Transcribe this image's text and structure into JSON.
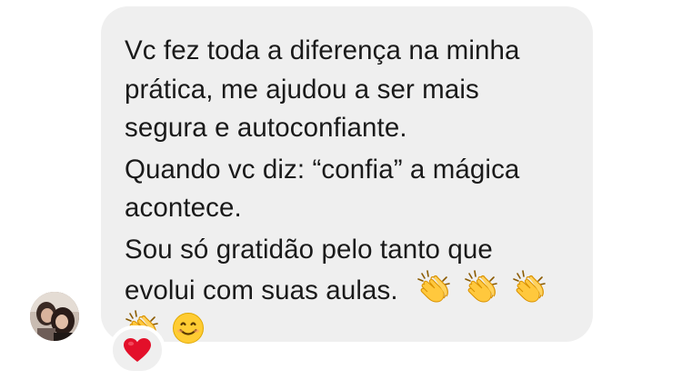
{
  "message": {
    "paragraphs": [
      [
        "Vc fez toda a diferença na minha",
        "prática, me ajudou a ser mais",
        "segura e autoconfiante."
      ],
      [
        "Quando vc diz: “confia” a mágica",
        "acontece."
      ],
      [
        "Sou só gratidão pelo tanto que",
        "evolui com suas aulas."
      ]
    ],
    "emojis_line_end": [
      "clapping-hands",
      "clapping-hands",
      "clapping-hands"
    ],
    "emojis_last_line": [
      "clapping-hands",
      "smiling-face"
    ]
  },
  "reaction": {
    "emoji": "red-heart",
    "heart_color": "#e3102a"
  },
  "colors": {
    "bubble_bg": "#efefef",
    "text": "#1a1a1a"
  }
}
